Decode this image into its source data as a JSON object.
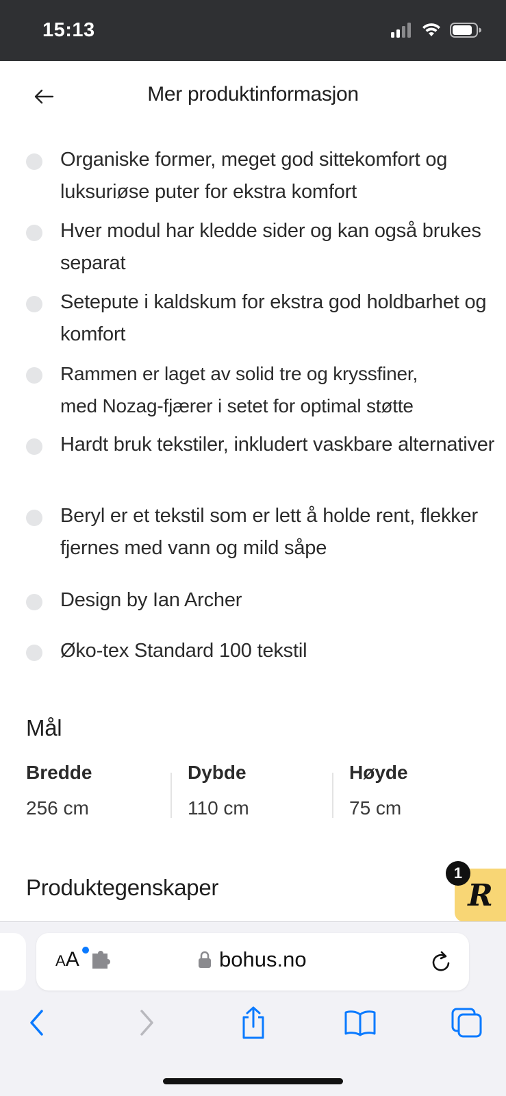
{
  "status_bar": {
    "time": "15:13"
  },
  "header": {
    "title": "Mer produktinformasjon"
  },
  "features": [
    "Organiske former, meget god sittekomfort og luksuriøse puter for ekstra komfort",
    "Hver modul har kledde sider og kan også brukes separat",
    "Setepute i kaldskum for ekstra god holdbarhet og komfort",
    "Rammen er laget av solid tre og kryssfiner, med Nozag-fjærer i setet for optimal støtte",
    "Hardt bruk tekstiler, inkludert vaskbare alternativer",
    "Beryl er et tekstil som er lett å holde rent, flekker fjernes med vann og mild såpe",
    "Design by Ian Archer",
    "Øko-tex Standard 100 tekstil"
  ],
  "dimensions": {
    "title": "Mål",
    "items": [
      {
        "label": "Bredde",
        "value": "256 cm"
      },
      {
        "label": "Dybde",
        "value": "110 cm"
      },
      {
        "label": "Høyde",
        "value": "75 cm"
      }
    ]
  },
  "properties": {
    "title": "Produktegenskaper"
  },
  "review_widget": {
    "letter": "R",
    "count": "1"
  },
  "browser": {
    "aa_small": "A",
    "aa_large": "A",
    "url": "bohus.no"
  },
  "icons": [
    "back-arrow-icon",
    "signal-icon",
    "wifi-icon",
    "battery-icon",
    "extension-icon",
    "lock-icon",
    "reload-icon",
    "back-chevron-icon",
    "forward-chevron-icon",
    "share-icon",
    "bookmarks-icon",
    "tabs-icon"
  ],
  "colors": {
    "status_bar": "#2f3033",
    "bullet": "#e4e5e7",
    "review_badge": "#f8d675",
    "ios_blue": "#0a7aff"
  }
}
